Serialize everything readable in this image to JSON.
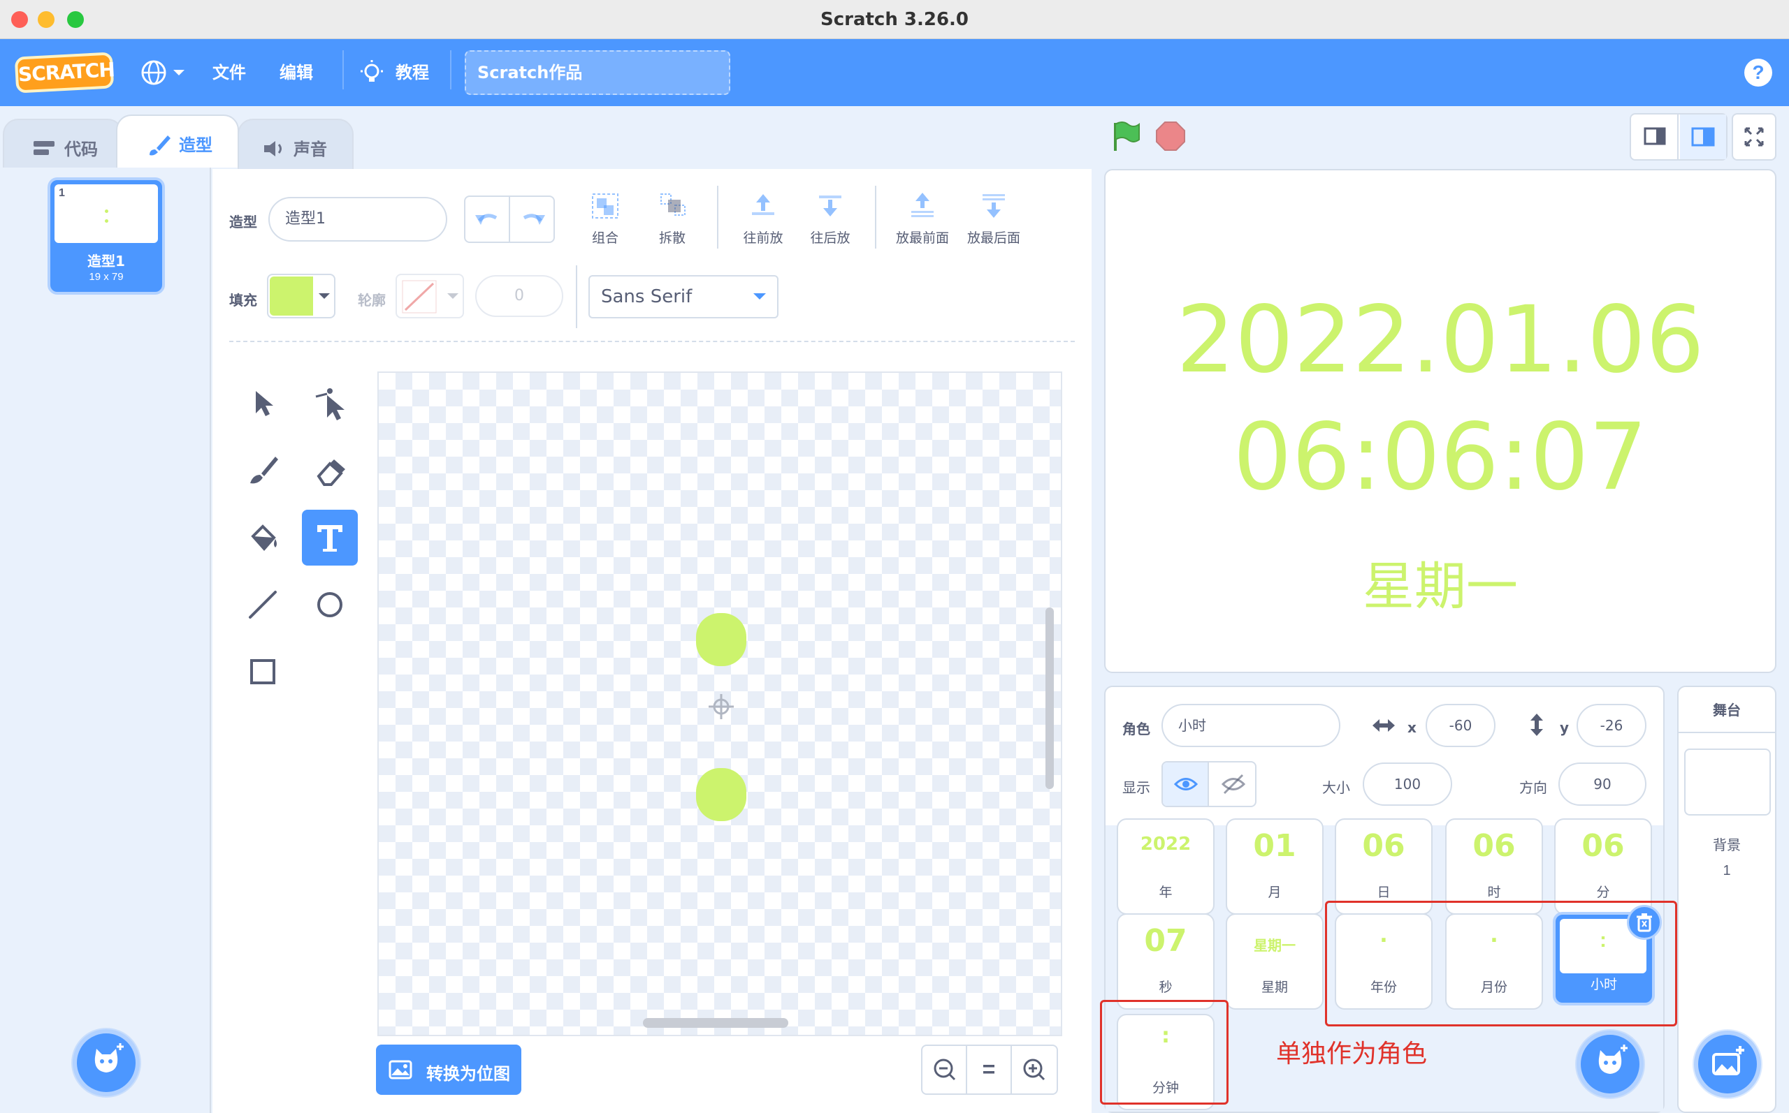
{
  "window": {
    "title": "Scratch 3.26.0"
  },
  "menubar": {
    "logo": "SCRATCH",
    "file": "文件",
    "edit": "编辑",
    "tutorials": "教程",
    "project_title": "Scratch作品",
    "help": "?"
  },
  "tabs": {
    "code": "代码",
    "costumes": "造型",
    "sounds": "声音"
  },
  "costume_list": {
    "items": [
      {
        "num": "1",
        "name": "造型1",
        "size": "19 x 79"
      }
    ]
  },
  "editor": {
    "costume_label": "造型",
    "costume_name": "造型1",
    "fill_label": "填充",
    "fill_color": "#ccf36d",
    "outline_label": "轮廓",
    "outline_width": "0",
    "font": "Sans Serif",
    "group": "组合",
    "ungroup": "拆散",
    "forward": "往前放",
    "backward": "往后放",
    "front": "放最前面",
    "back": "放最后面",
    "convert_bitmap": "转换为位图",
    "zoom_reset": "="
  },
  "stage": {
    "date": "2022.01.06",
    "time": "06:06:07",
    "weekday": "星期一",
    "text_color": "#ccf36d"
  },
  "sprite_info": {
    "sprite_label": "角色",
    "sprite_name": "小时",
    "x_label": "x",
    "x": "-60",
    "y_label": "y",
    "y": "-26",
    "show_label": "显示",
    "size_label": "大小",
    "size": "100",
    "direction_label": "方向",
    "direction": "90"
  },
  "sprites": [
    {
      "big": "2022",
      "name": "年"
    },
    {
      "big": "01",
      "name": "月"
    },
    {
      "big": "06",
      "name": "日"
    },
    {
      "big": "06",
      "name": "时"
    },
    {
      "big": "06",
      "name": "分"
    },
    {
      "big": "07",
      "name": "秒"
    },
    {
      "big": "星期一",
      "name": "星期"
    },
    {
      "big": ".",
      "name": "年份"
    },
    {
      "big": ".",
      "name": "月份"
    },
    {
      "big": ":",
      "name": "小时"
    },
    {
      "big": ":",
      "name": "分钟"
    }
  ],
  "annotation": "单独作为角色",
  "stage_pane": {
    "title": "舞台",
    "backdrop_label": "背景",
    "backdrop_count": "1"
  }
}
